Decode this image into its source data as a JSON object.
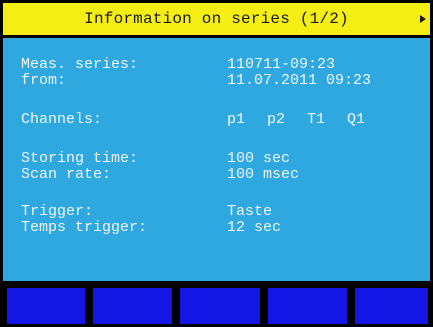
{
  "header": {
    "title": "Information on series (1/2)",
    "next_icon": "triangle-right-icon"
  },
  "info": {
    "meas_series": {
      "label": "Meas. series:",
      "value": "110711-09:23"
    },
    "from": {
      "label": "from:",
      "value": "11.07.2011 09:23"
    },
    "channels": {
      "label": "Channels:",
      "values": [
        "p1",
        "p2",
        "T1",
        "Q1"
      ]
    },
    "storing_time": {
      "label": "Storing time:",
      "value": "100 sec"
    },
    "scan_rate": {
      "label": "Scan rate:",
      "value": "100 msec"
    },
    "trigger": {
      "label": "Trigger:",
      "value": "Taste"
    },
    "temps_trigger": {
      "label": "Temps trigger:",
      "value": "12 sec"
    }
  },
  "softkeys": [
    "",
    "",
    "",
    "",
    ""
  ],
  "colors": {
    "title_bg": "#f5ee15",
    "panel_bg": "#2ea8de",
    "softkey_bg": "#1416e6",
    "text": "#eef6fb",
    "frame": "#000000"
  }
}
